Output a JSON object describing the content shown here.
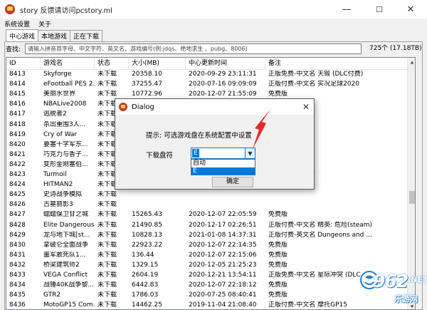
{
  "window": {
    "title": "story 反馈请访问pcstory.ml",
    "minimize_glyph": "—",
    "maximize_glyph": "☐",
    "close_glyph": "✕"
  },
  "menu": [
    "系统设置",
    "关于"
  ],
  "tabs": [
    {
      "label": "中心游戏",
      "active": true
    },
    {
      "label": "本地游戏",
      "active": false
    },
    {
      "label": "正在下载",
      "active": false
    }
  ],
  "search": {
    "label": "查找:",
    "placeholder": "请输入拼音首字母、中文字符、英文名、游戏编号(例:jdqs、绝地求生 、pubg、8006)",
    "value": "",
    "count_text": "725个 (17.18TB)"
  },
  "table": {
    "columns": [
      "ID",
      "游戏名",
      "状态",
      "大小(MB)",
      "中心更新时间",
      "备注"
    ],
    "rows": [
      [
        "8413",
        "Skyforge",
        "未下载",
        "20358.10",
        "2020-09-29 23:11:31",
        "正版免费-中文名 天锻 (DLC付费)"
      ],
      [
        "8414",
        "eFootball PES 2...",
        "未下载",
        "37255.47",
        "2020-07-16 09:09:09",
        "正版付费-中文名 实况足球2020"
      ],
      [
        "8415",
        "美丽水世界",
        "未下载",
        "10772.96",
        "2020-12-07 21:55:09",
        "免费版"
      ],
      [
        "8416",
        "NBALive2008",
        "未下载",
        "",
        "",
        ""
      ],
      [
        "8417",
        "逃脱者2",
        "未下载",
        "",
        "",
        ""
      ],
      [
        "8418",
        "杀出重围3人...",
        "未下载",
        "",
        "",
        ""
      ],
      [
        "8419",
        "Cry of War",
        "未下载",
        "",
        "",
        "中文名 战争号角"
      ],
      [
        "8420",
        "要塞十字军东...",
        "未下载",
        "",
        "",
        ""
      ],
      [
        "8421",
        "巧克力与香子...",
        "未下载",
        "",
        "",
        ""
      ],
      [
        "8422",
        "变形金刚塞伯...",
        "未下载",
        "",
        "",
        ""
      ],
      [
        "8423",
        "Turmoil",
        "未下载",
        "",
        "",
        "中文名 石油大亨"
      ],
      [
        "8424",
        "HITMAN2",
        "未下载",
        "",
        "",
        "中文名 杀手2"
      ],
      [
        "8425",
        "史诗战争模拟",
        "未下载",
        "",
        "",
        ""
      ],
      [
        "8426",
        "古墓丽影3",
        "未下载",
        "",
        "",
        ""
      ],
      [
        "8427",
        "蠕蠕保卫甘之城",
        "未下载",
        "15265.43",
        "2020-12-07 22:05:59",
        "免费版"
      ],
      [
        "8428",
        "Elite Dangerous",
        "未下载",
        "21490.85",
        "2020-12-17 02:26:51",
        "正版付费-中文名 精英: 危险(steam)"
      ],
      [
        "8429",
        "龙与地下城[st...",
        "未下载",
        "10828.13",
        "2021-01-08 14:37:31",
        "正版付费-英文名 Dungeons and ..."
      ],
      [
        "8430",
        "拿破仑全面战争",
        "未下载",
        "22923.22",
        "2020-12-07 22:14:35",
        "免费版"
      ],
      [
        "8431",
        "噩军敢死队1...",
        "未下载",
        "136.44",
        "2020-12-07 22:15:06",
        "免费版"
      ],
      [
        "8432",
        "桥梁建筑师2",
        "未下载",
        "1329.15",
        "2020-12-05 21:25:23",
        "免费版"
      ],
      [
        "8433",
        "VEGA Conflict",
        "未下载",
        "2604.19",
        "2020-12-21 13:54:11",
        "正版免费-中文名 星际冲突 (DLC..."
      ],
      [
        "8434",
        "战锤40K战争黎...",
        "未下载",
        "6442.83",
        "2020-12-07 22:18:12",
        "免费版"
      ],
      [
        "8435",
        "GTR2",
        "未下载",
        "1786.03",
        "2020-07-25 08:40:41",
        "免费版"
      ],
      [
        "8436",
        "MotoGP15 Com...",
        "未下载",
        "14462.25",
        "2019-11-04 21:08:40",
        "正版付费-中文名 摩托GP15"
      ]
    ]
  },
  "dialog": {
    "title": "Dialog",
    "close_glyph": "✕",
    "hint": "提示: 可选游戏盘在系统配置中设置",
    "drive_label": "下载盘符",
    "selected": "E",
    "options": [
      "自动",
      "E"
    ],
    "ok_label": "确定"
  },
  "watermark": {
    "number": "962",
    "net": ".NET",
    "cn": "乐游网"
  },
  "colors": {
    "accent": "#0078d7",
    "arrow": "#e8262a",
    "watermark": "#2a7fcf"
  }
}
